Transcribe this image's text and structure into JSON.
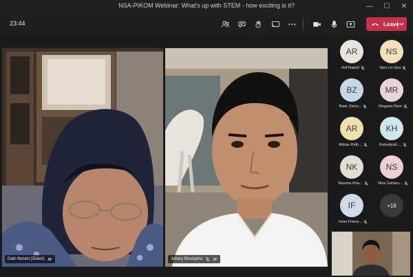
{
  "window": {
    "title": "NSA-PIKOM Webinar: What's up with STEM - how exciting is it?",
    "controls": {
      "minimize": "—",
      "maximize": "☐",
      "close": "✕"
    }
  },
  "toolbar": {
    "timer": "23:44",
    "buttons": [
      {
        "name": "participants-icon"
      },
      {
        "name": "chat-icon"
      },
      {
        "name": "reactions-icon"
      },
      {
        "name": "share-tray-icon"
      },
      {
        "name": "more-actions-icon"
      },
      {
        "name": "camera-icon"
      },
      {
        "name": "microphone-icon"
      },
      {
        "name": "share-screen-icon"
      }
    ],
    "leave_label": "Leave",
    "leave_color": "#c4314b"
  },
  "videos": {
    "left": {
      "name": "Dato Norani (Guest)"
    },
    "right": {
      "name": "Johary Mustapha"
    }
  },
  "participants": [
    {
      "initials": "AR",
      "name": "Arif Radzif",
      "color": "#e8e4dc"
    },
    {
      "initials": "NS",
      "name": "Nen Lin Soo",
      "color": "#f3e0b8"
    },
    {
      "initials": "BZ",
      "name": "Basir Zainu...",
      "color": "#c6d8e6"
    },
    {
      "initials": "MR",
      "name": "Mogana Ram",
      "color": "#e9d2dc"
    },
    {
      "initials": "AR",
      "name": "Abbas Ridh...",
      "color": "#f1dfae"
    },
    {
      "initials": "KH",
      "name": "Kamaliyah ...",
      "color": "#cfe7ea"
    },
    {
      "initials": "NK",
      "name": "Nasuha Kha...",
      "color": "#e4ddd4"
    },
    {
      "initials": "NS",
      "name": "Nisa Saharu...",
      "color": "#ead0d0"
    },
    {
      "initials": "IF",
      "name": "Inme Fransi...",
      "color": "#cfdbe8"
    }
  ],
  "more_participants": "+16"
}
